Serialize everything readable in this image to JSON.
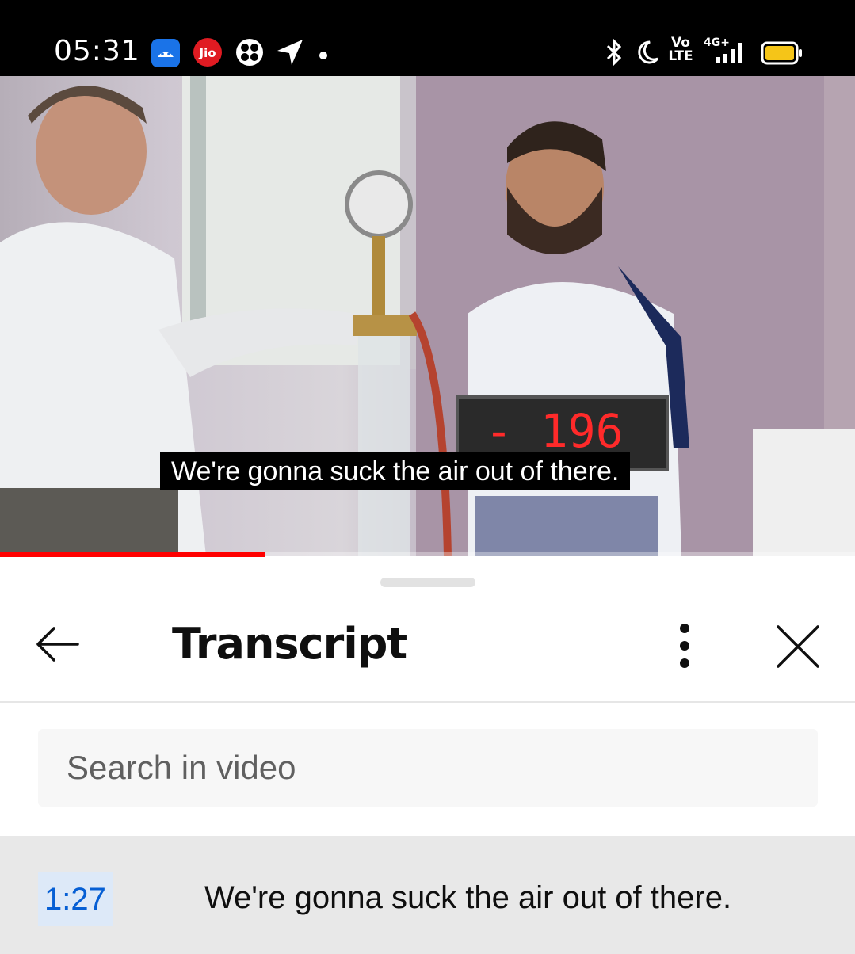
{
  "status_bar": {
    "time": "05:31",
    "left_icons": [
      "android-notification-icon",
      "jio-icon",
      "fan-icon",
      "location-arrow-icon",
      "dot-icon"
    ],
    "right_icons": [
      "bluetooth-icon",
      "do-not-disturb-moon-icon",
      "volte-icon",
      "signal-4g-icon",
      "battery-icon"
    ],
    "volte_label_top": "Vo",
    "volte_label_bottom": "LTE",
    "network_label": "4G+"
  },
  "video": {
    "caption": "We're gonna suck the air out of there.",
    "display_readout": "- 196",
    "progress_fraction": 0.31,
    "progress_color": "#ff0000"
  },
  "transcript_panel": {
    "title": "Transcript",
    "search_placeholder": "Search in video",
    "segments": [
      {
        "timestamp": "1:27",
        "text": "We're gonna suck the air out of there."
      }
    ]
  },
  "colors": {
    "timestamp_text": "#065fd4",
    "timestamp_bg": "#dde9f8",
    "active_row_bg": "#e8e8e8"
  }
}
